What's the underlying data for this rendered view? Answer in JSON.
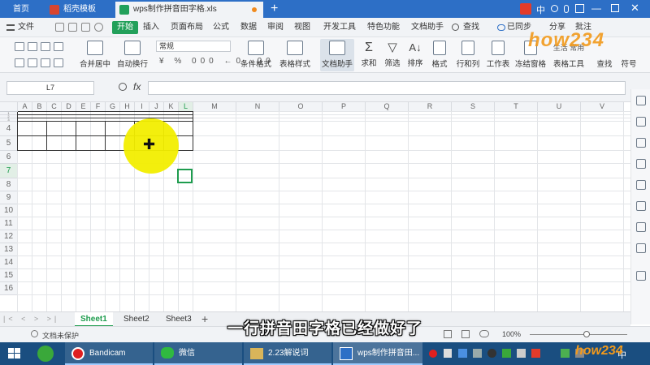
{
  "tabs": [
    {
      "label": "首页"
    },
    {
      "label": "稻壳模板"
    },
    {
      "label": "wps制作拼音田字格.xls"
    }
  ],
  "window": {
    "sync_label": "已同步",
    "share_label": "分享",
    "comment_label": "批注"
  },
  "menu": {
    "file": "文件",
    "items": [
      "开始",
      "插入",
      "页面布局",
      "公式",
      "数据",
      "审阅",
      "视图",
      "开发工具",
      "特色功能",
      "文档助手"
    ],
    "search": "查找"
  },
  "ribbon": {
    "number_format": "常规",
    "merge": "合并居中",
    "wrap": "自动换行",
    "cond_format": "条件格式",
    "table_style": "表格样式",
    "doc_helper": "文档助手",
    "sum": "求和",
    "filter": "筛选",
    "sort": "排序",
    "format": "格式",
    "rows_cols": "行和列",
    "worksheet": "工作表",
    "freeze": "冻结窗格",
    "table_tools": "表格工具",
    "find": "查找",
    "symbol": "符号",
    "brand_label": "生活 常用"
  },
  "formula_bar": {
    "cell_ref": "L7",
    "fx": "fx",
    "value": ""
  },
  "grid": {
    "columns": [
      "A",
      "B",
      "C",
      "D",
      "E",
      "F",
      "G",
      "H",
      "I",
      "J",
      "K",
      "L",
      "M",
      "N",
      "O",
      "P",
      "Q",
      "R",
      "S",
      "T",
      "U",
      "V"
    ],
    "rows": [
      "1",
      "2",
      "3",
      "4",
      "5",
      "6",
      "7",
      "8",
      "9",
      "10",
      "11",
      "12",
      "13",
      "14",
      "15",
      "16"
    ],
    "active_cell": "L7",
    "cursor_icon": "cross-cursor-icon"
  },
  "sheets": {
    "items": [
      "Sheet1",
      "Sheet2",
      "Sheet3"
    ],
    "active": "Sheet1",
    "add": "+"
  },
  "status": {
    "protect": "文档未保护",
    "zoom": "100%"
  },
  "taskbar": {
    "apps": [
      {
        "label": "Bandicam"
      },
      {
        "label": "微信"
      },
      {
        "label": "2.23解说词"
      },
      {
        "label": "wps制作拼音田..."
      }
    ],
    "ime": "中"
  },
  "caption": "一行拼音田字格已经做好了",
  "watermark": "how234",
  "colors": {
    "accent_green": "#22a05a",
    "title_blue": "#2d6fc6",
    "taskbar": "#1a4e80",
    "highlight": "#f2ee00"
  }
}
